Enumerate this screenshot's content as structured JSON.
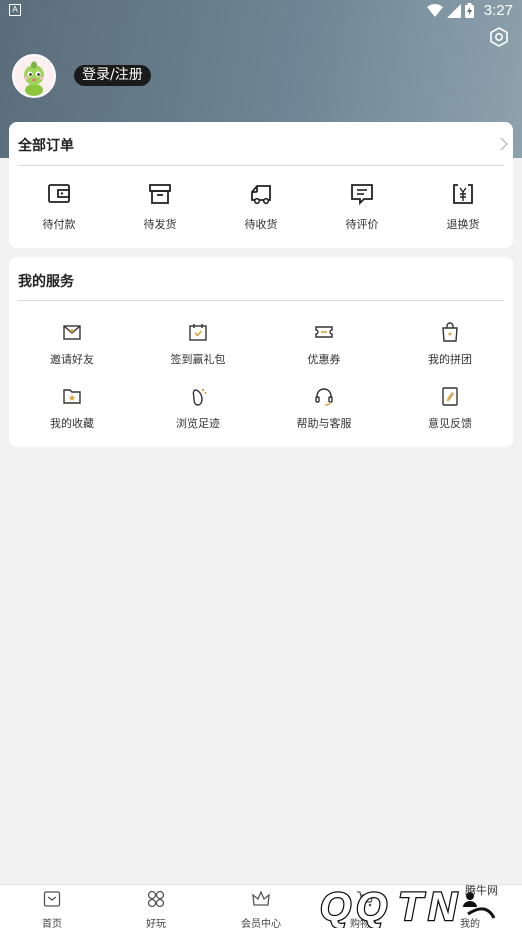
{
  "status_bar": {
    "time": "3:27",
    "sim_label": "A"
  },
  "header": {
    "login_label": "登录/注册"
  },
  "orders": {
    "title": "全部订单",
    "items": [
      {
        "label": "待付款",
        "icon": "wallet-icon"
      },
      {
        "label": "待发货",
        "icon": "box-icon"
      },
      {
        "label": "待收货",
        "icon": "truck-icon"
      },
      {
        "label": "待评价",
        "icon": "comment-icon"
      },
      {
        "label": "退换货",
        "icon": "return-icon"
      }
    ]
  },
  "services": {
    "title": "我的服务",
    "items": [
      {
        "label": "邀请好友",
        "icon": "envelope-icon"
      },
      {
        "label": "签到赢礼包",
        "icon": "calendar-icon"
      },
      {
        "label": "优惠券",
        "icon": "coupon-icon"
      },
      {
        "label": "我的拼团",
        "icon": "bag-icon"
      },
      {
        "label": "我的收藏",
        "icon": "folder-star-icon"
      },
      {
        "label": "浏览足迹",
        "icon": "footprint-icon"
      },
      {
        "label": "帮助与客服",
        "icon": "headset-icon"
      },
      {
        "label": "意见反馈",
        "icon": "feedback-icon"
      }
    ]
  },
  "tabbar": {
    "items": [
      {
        "label": "首页",
        "icon": "home-icon"
      },
      {
        "label": "好玩",
        "icon": "grid-icon"
      },
      {
        "label": "会员中心",
        "icon": "crown-icon"
      },
      {
        "label": "购物车",
        "icon": "cart-icon"
      },
      {
        "label": "我的",
        "icon": "user-icon"
      }
    ]
  },
  "watermark": {
    "text": "腾牛网",
    "logo": "QQTN"
  },
  "colors": {
    "header_start": "#5b6d7b",
    "header_end": "#8ea2ad",
    "accent": "#1a1a1a",
    "coupon_accent": "#d9a441"
  }
}
